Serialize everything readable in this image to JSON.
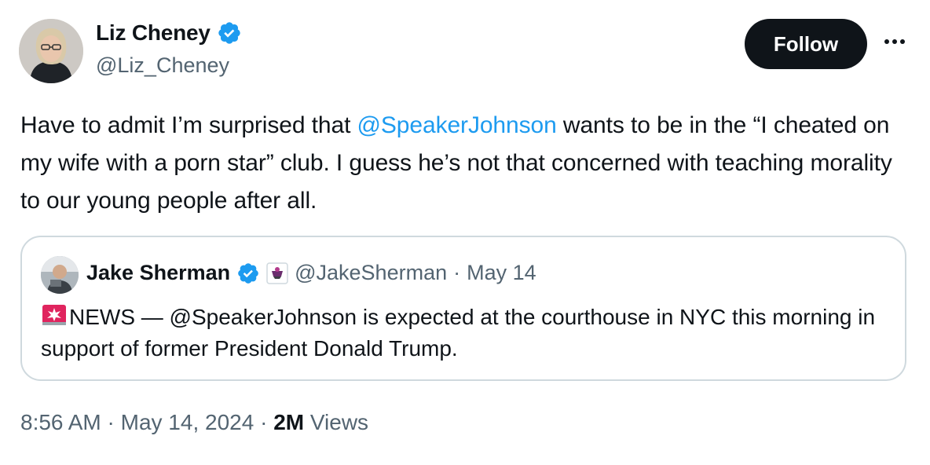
{
  "author": {
    "name": "Liz Cheney",
    "handle": "@Liz_Cheney",
    "verified_color": "#1d9bf0"
  },
  "actions": {
    "follow_label": "Follow",
    "more_icon": "more-horizontal-icon"
  },
  "tweet": {
    "text_part1": "Have to admit I’m surprised that ",
    "mention": "@SpeakerJohnson",
    "text_part2": " wants to be in the “I cheated on my wife with a porn star” club. I guess he’s not that concerned with teaching morality to our young people after all."
  },
  "quote": {
    "name": "Jake Sherman",
    "handle": "@JakeSherman",
    "separator": "·",
    "date": "May 14",
    "siren_icon": "rotating-light-icon",
    "text": "NEWS — @SpeakerJohnson is expected at the courthouse in NYC this morning in support of former President Donald Trump."
  },
  "footer": {
    "time": "8:56 AM",
    "sep1": "·",
    "date": "May 14, 2024",
    "sep2": "·",
    "views_count": "2M",
    "views_label": "Views"
  },
  "colors": {
    "text": "#0f1419",
    "secondary": "#536471",
    "link": "#1d9bf0",
    "border": "#cfd9de"
  }
}
